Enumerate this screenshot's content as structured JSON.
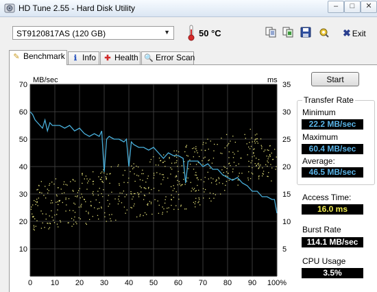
{
  "window": {
    "title": "HD Tune 2.55 - Hard Disk Utility",
    "controls": [
      "–",
      "□",
      "✕"
    ]
  },
  "toolbar": {
    "drive": "ST9120817AS (120 GB)",
    "temperature": "50 °C",
    "exit_label": "Exit",
    "icons": [
      "copy-text-icon",
      "copy-screenshot-icon",
      "save-icon",
      "options-icon"
    ]
  },
  "tabs": [
    {
      "label": "Benchmark",
      "icon": "benchmark-icon",
      "active": true
    },
    {
      "label": "Info",
      "icon": "info-icon",
      "active": false
    },
    {
      "label": "Health",
      "icon": "health-icon",
      "active": false
    },
    {
      "label": "Error Scan",
      "icon": "error-scan-icon",
      "active": false
    }
  ],
  "start_button": "Start",
  "results": {
    "transfer_rate_title": "Transfer Rate",
    "minimum_label": "Minimum",
    "minimum_value": "22.2 MB/sec",
    "maximum_label": "Maximum",
    "maximum_value": "60.4 MB/sec",
    "average_label": "Average:",
    "average_value": "46.5 MB/sec",
    "access_time_label": "Access Time:",
    "access_time_value": "16.0 ms",
    "burst_rate_label": "Burst Rate",
    "burst_rate_value": "114.1 MB/sec",
    "cpu_usage_label": "CPU Usage",
    "cpu_usage_value": "3.5%"
  },
  "colors": {
    "plot_background": "#000000",
    "grid": "#3a3a3a",
    "transfer_line": "#4ab0dc",
    "access_dots": "#e6e27a"
  },
  "chart_data": {
    "type": "line",
    "ylabel_left": "MB/sec",
    "ylabel_right": "ms",
    "ylim_left": [
      0,
      70
    ],
    "ylim_right": [
      0,
      35
    ],
    "xlim": [
      0,
      100
    ],
    "y_ticks_left": [
      "70",
      "60",
      "50",
      "40",
      "30",
      "20",
      "10"
    ],
    "y_ticks_right": [
      "35",
      "30",
      "25",
      "20",
      "15",
      "10",
      "5"
    ],
    "x_ticks": [
      "0",
      "10",
      "20",
      "30",
      "40",
      "50",
      "60",
      "70",
      "80",
      "90",
      "100%"
    ],
    "grid": true,
    "series": [
      {
        "unit": "MB/sec",
        "x": [
          0,
          1,
          2,
          3,
          4,
          5,
          6,
          7,
          8,
          9,
          10,
          12,
          14,
          16,
          18,
          20,
          22,
          24,
          26,
          28,
          29,
          30,
          31,
          32,
          34,
          36,
          38,
          39,
          40,
          41,
          42,
          44,
          46,
          48,
          50,
          52,
          54,
          56,
          58,
          60,
          62,
          63,
          64,
          66,
          68,
          70,
          72,
          74,
          76,
          78,
          80,
          82,
          84,
          86,
          88,
          90,
          92,
          94,
          96,
          98,
          99,
          100
        ],
        "y": [
          60,
          59,
          57,
          56,
          55,
          54,
          57,
          53,
          56,
          55,
          55,
          55,
          54,
          55,
          53,
          54,
          52,
          51,
          52,
          51,
          53,
          38,
          50,
          51,
          50,
          50,
          49,
          50,
          40,
          49,
          48,
          47,
          47,
          46,
          47,
          45,
          43,
          45,
          44,
          44,
          43,
          34,
          42,
          42,
          42,
          40,
          41,
          39,
          39,
          37,
          36,
          35,
          36,
          34,
          33,
          31,
          31,
          29,
          29,
          28,
          28,
          23
        ]
      },
      {
        "unit": "ms",
        "type": "scatter",
        "y_range_by_x": [
          {
            "x": 0,
            "y": [
              8,
              17
            ]
          },
          {
            "x": 30,
            "y": [
              10,
              20
            ]
          },
          {
            "x": 50,
            "y": [
              11,
              22
            ]
          },
          {
            "x": 70,
            "y": [
              13,
              25
            ]
          },
          {
            "x": 90,
            "y": [
              18,
              27
            ]
          },
          {
            "x": 100,
            "y": [
              17,
              23
            ]
          }
        ]
      }
    ]
  }
}
